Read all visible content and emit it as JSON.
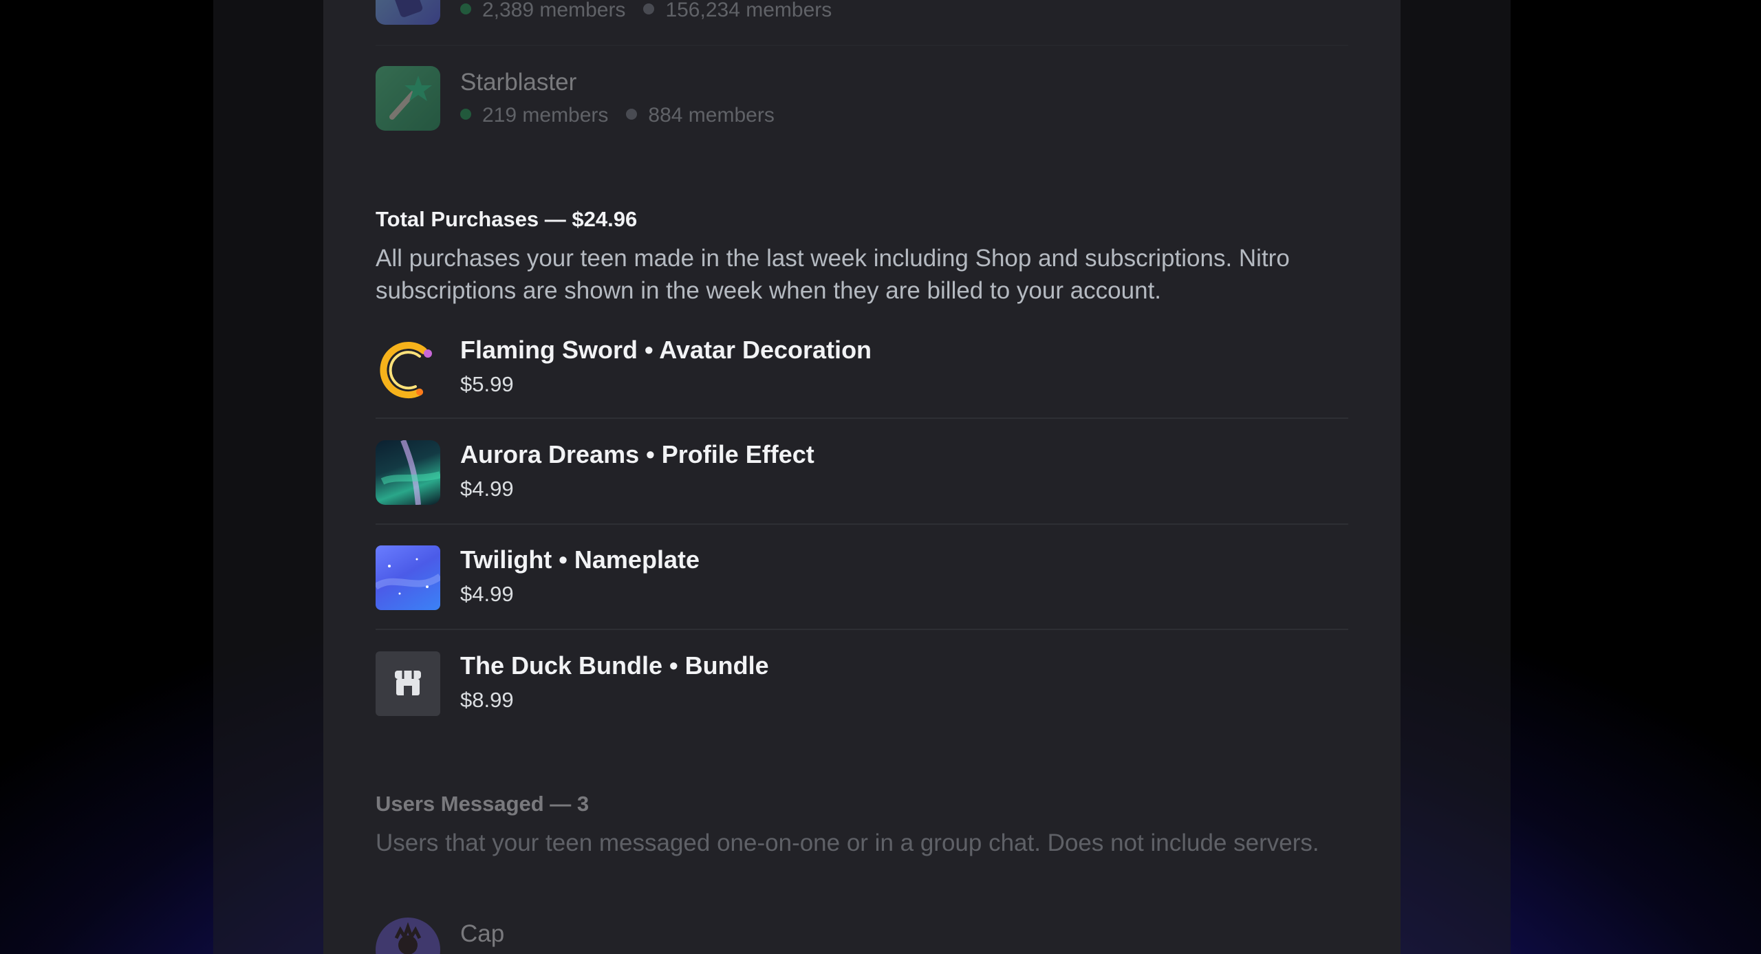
{
  "servers": [
    {
      "name": "",
      "online": "2,389 members",
      "total": "156,234 members"
    },
    {
      "name": "Starblaster",
      "online": "219 members",
      "total": "884 members"
    }
  ],
  "purchases": {
    "title": "Total Purchases — $24.96",
    "description": "All purchases your teen made in the last week including Shop and subscriptions. Nitro subscriptions are shown in the week when they are billed to your account.",
    "items": [
      {
        "name": "Flaming Sword • Avatar Decoration",
        "price": "$5.99",
        "icon": "flaming-sword-icon"
      },
      {
        "name": "Aurora Dreams • Profile Effect",
        "price": "$4.99",
        "icon": "aurora-icon"
      },
      {
        "name": "Twilight • Nameplate",
        "price": "$4.99",
        "icon": "twilight-icon"
      },
      {
        "name": "The Duck Bundle • Bundle",
        "price": "$8.99",
        "icon": "shop-icon"
      }
    ]
  },
  "users_messaged": {
    "title": "Users Messaged — 3",
    "description": "Users that your teen messaged one-on-one or in a group chat. Does not include servers.",
    "users": [
      {
        "name": "Cap"
      }
    ]
  },
  "colors": {
    "online": "#23a55a",
    "offline": "#80848e",
    "panel": "#222227",
    "accent_glow": "#2a2bd0"
  }
}
